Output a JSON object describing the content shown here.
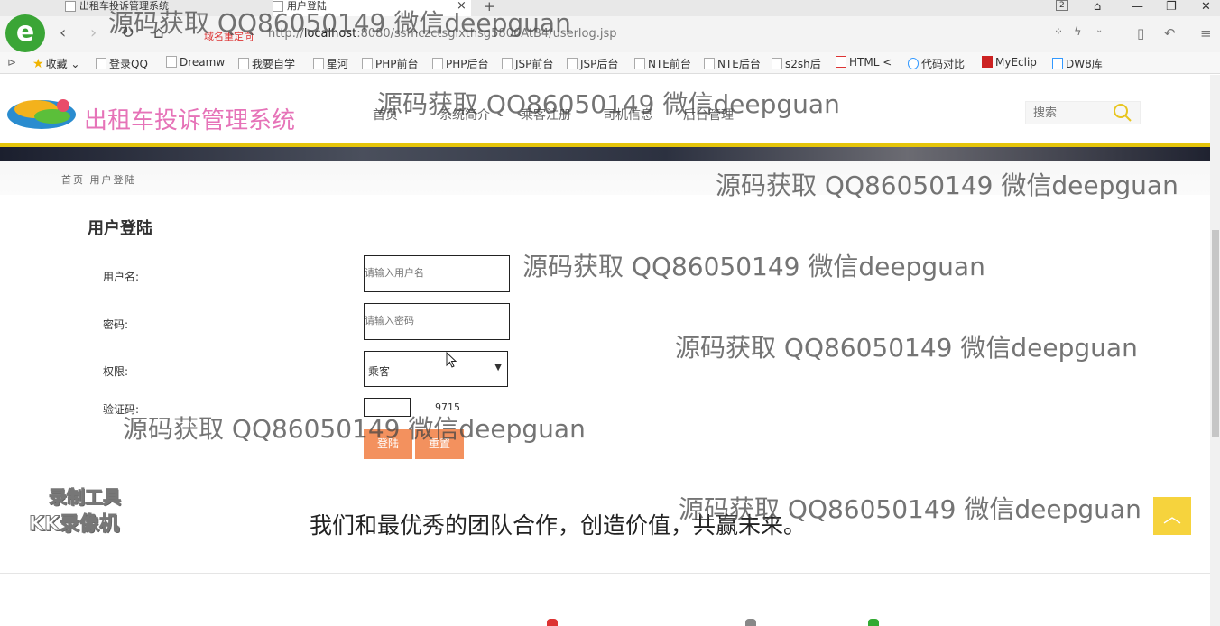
{
  "browser": {
    "tabs": [
      {
        "label": "出租车投诉管理系统",
        "active": false
      },
      {
        "label": "用户登陆",
        "active": true
      }
    ],
    "tab_close": "×",
    "tab_new": "+",
    "window_badge": "2",
    "redirect_text": "域名重定向",
    "url_prefix": "http://",
    "url_host": "localhost",
    "url_rest": ":8080/ssmczctsglxthsg5806AtB4/userlog.jsp",
    "bookmarks": [
      "收藏",
      "登录QQ",
      "Dreamw",
      "我要自学",
      "星河",
      "PHP前台",
      "PHP后台",
      "JSP前台",
      "JSP后台",
      "NTE前台",
      "NTE后台",
      "s2sh后",
      "HTML <",
      "代码对比",
      "MyEclip",
      "DW8库"
    ]
  },
  "header": {
    "site_title": "出租车投诉管理系统",
    "menu": [
      "首页",
      "系统简介",
      "乘客注册",
      "司机信息",
      "后台管理"
    ],
    "search_placeholder": "搜索"
  },
  "breadcrumb": "首页 用户登陆",
  "login": {
    "title": "用户登陆",
    "username_label": "用户名:",
    "username_placeholder": "请输入用户名",
    "password_label": "密码:",
    "password_placeholder": "请输入密码",
    "role_label": "权限:",
    "role_value": "乘客",
    "captcha_label": "验证码:",
    "captcha_code": "9715",
    "login_button": "登陆",
    "reset_button": "重置"
  },
  "slogan": "我们和最优秀的团队合作，创造价值，共赢未来。",
  "recorder": {
    "line1": "录制工具",
    "line2": "KK录像机"
  },
  "watermark": "源码获取 QQ86050149 微信deepguan",
  "colors": {
    "accent": "#f3915e",
    "title_pink": "#e673b8",
    "divider_yellow": "#e5c50a",
    "totop": "#f6d33d"
  }
}
